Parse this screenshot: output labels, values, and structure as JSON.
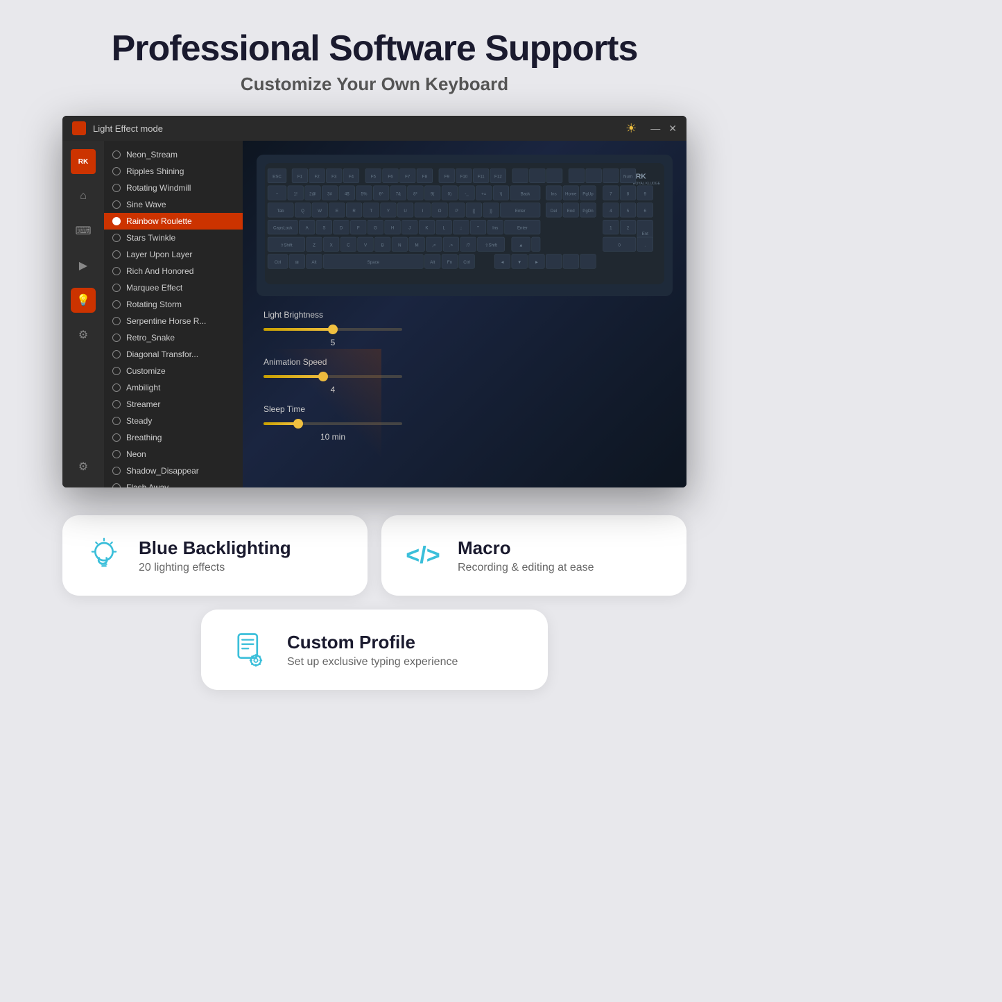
{
  "header": {
    "title": "Professional Software Supports",
    "subtitle": "Customize Your Own Keyboard"
  },
  "window": {
    "title": "Light Effect mode",
    "minimize": "—",
    "close": "✕"
  },
  "effects": [
    {
      "id": "neon_stream",
      "label": "Neon_Stream",
      "active": false
    },
    {
      "id": "ripples_shining",
      "label": "Ripples Shining",
      "active": false
    },
    {
      "id": "rotating_windmill",
      "label": "Rotating Windmill",
      "active": false
    },
    {
      "id": "sine_wave",
      "label": "Sine Wave",
      "active": false
    },
    {
      "id": "rainbow_roulette",
      "label": "Rainbow Roulette",
      "active": true
    },
    {
      "id": "stars_twinkle",
      "label": "Stars Twinkle",
      "active": false
    },
    {
      "id": "layer_upon_layer",
      "label": "Layer Upon Layer",
      "active": false
    },
    {
      "id": "rich_and_honored",
      "label": "Rich And Honored",
      "active": false
    },
    {
      "id": "marquee_effect",
      "label": "Marquee Effect",
      "active": false
    },
    {
      "id": "rotating_storm",
      "label": "Rotating Storm",
      "active": false
    },
    {
      "id": "serpentine_horse",
      "label": "Serpentine Horse R...",
      "active": false
    },
    {
      "id": "retro_snake",
      "label": "Retro_Snake",
      "active": false
    },
    {
      "id": "diagonal_transfor",
      "label": "Diagonal Transfor...",
      "active": false
    },
    {
      "id": "customize",
      "label": "Customize",
      "active": false
    },
    {
      "id": "ambilight",
      "label": "Ambilight",
      "active": false
    },
    {
      "id": "streamer",
      "label": "Streamer",
      "active": false
    },
    {
      "id": "steady",
      "label": "Steady",
      "active": false
    },
    {
      "id": "breathing",
      "label": "Breathing",
      "active": false
    },
    {
      "id": "neon",
      "label": "Neon",
      "active": false
    },
    {
      "id": "shadow_disappear",
      "label": "Shadow_Disappear",
      "active": false
    },
    {
      "id": "flash_away",
      "label": "Flash Away",
      "active": false
    }
  ],
  "controls": {
    "brightness": {
      "label": "Light Brightness",
      "value": 5,
      "fill_pct": 50
    },
    "speed": {
      "label": "Animation Speed",
      "value": 4,
      "fill_pct": 43
    },
    "sleep": {
      "label": "Sleep Time",
      "value": "10 min",
      "fill_pct": 25
    }
  },
  "feature1": {
    "title": "Blue Backlighting",
    "desc": "20 lighting effects"
  },
  "feature2": {
    "title": "Macro",
    "desc": "Recording & editing at ease"
  },
  "feature3": {
    "title": "Custom Profile",
    "desc": "Set up exclusive typing experience"
  },
  "sidebar_icons": [
    "⌂",
    "⌨",
    "▶",
    "💡",
    "⚙"
  ],
  "sidebar2_icons": [
    "⌂",
    "⌨",
    "▶",
    "💡",
    "⚙",
    "⚙"
  ]
}
